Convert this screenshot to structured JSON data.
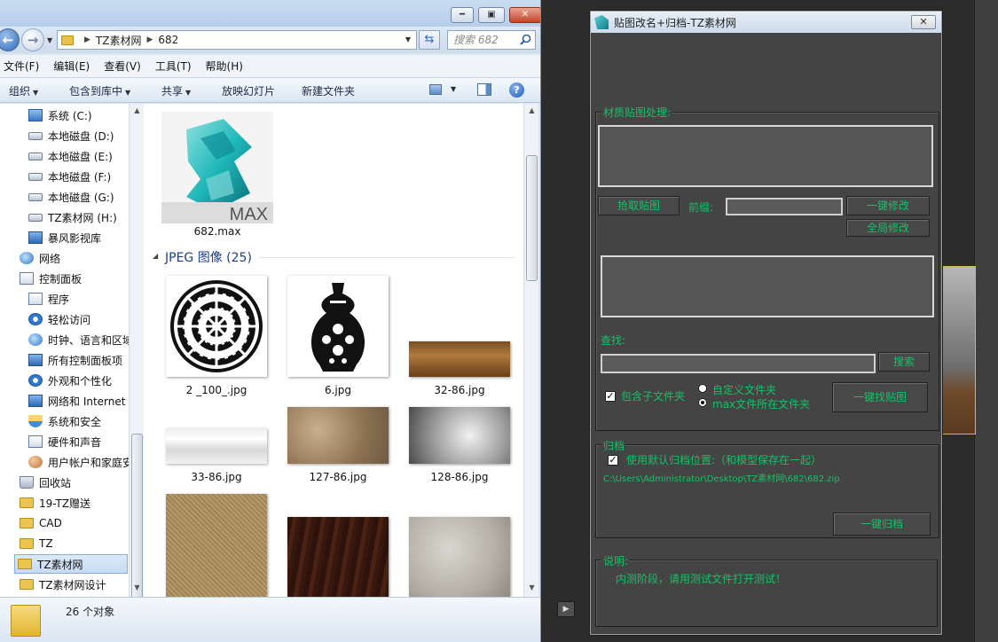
{
  "explorer": {
    "address": {
      "crumbs": [
        "TZ素材网",
        "682"
      ]
    },
    "search_placeholder": "搜索 682",
    "menu": [
      "文件(F)",
      "编辑(E)",
      "查看(V)",
      "工具(T)",
      "帮助(H)"
    ],
    "toolbar": {
      "organize": "组织",
      "include_library": "包含到库中",
      "share": "共享",
      "slideshow": "放映幻灯片",
      "new_folder": "新建文件夹"
    },
    "sidebar": [
      {
        "label": "系统 (C:)",
        "icon": "system-drive-icon"
      },
      {
        "label": "本地磁盘 (D:)",
        "icon": "drive-icon"
      },
      {
        "label": "本地磁盘 (E:)",
        "icon": "drive-icon"
      },
      {
        "label": "本地磁盘 (F:)",
        "icon": "drive-icon"
      },
      {
        "label": "本地磁盘 (G:)",
        "icon": "drive-icon"
      },
      {
        "label": "TZ素材网 (H:)",
        "icon": "drive-icon"
      },
      {
        "label": "暴风影视库",
        "icon": "media-library-icon"
      },
      {
        "label": "网络",
        "icon": "network-icon"
      },
      {
        "label": "控制面板",
        "icon": "control-panel-icon"
      },
      {
        "label": "程序",
        "icon": "programs-icon"
      },
      {
        "label": "轻松访问",
        "icon": "accessibility-icon"
      },
      {
        "label": "时钟、语言和区域",
        "icon": "clock-globe-icon"
      },
      {
        "label": "所有控制面板项",
        "icon": "control-panel-items-icon"
      },
      {
        "label": "外观和个性化",
        "icon": "appearance-icon"
      },
      {
        "label": "网络和 Internet",
        "icon": "network-internet-icon"
      },
      {
        "label": "系统和安全",
        "icon": "security-shield-icon"
      },
      {
        "label": "硬件和声音",
        "icon": "hardware-sound-icon"
      },
      {
        "label": "用户帐户和家庭安全",
        "icon": "user-accounts-icon"
      },
      {
        "label": "回收站",
        "icon": "recycle-bin-icon"
      },
      {
        "label": "19-TZ赠送",
        "icon": "folder-icon"
      },
      {
        "label": "CAD",
        "icon": "folder-icon"
      },
      {
        "label": "TZ",
        "icon": "folder-icon"
      },
      {
        "label": "TZ素材网",
        "icon": "folder-icon",
        "selected": true
      },
      {
        "label": "TZ素材网设计",
        "icon": "folder-icon"
      }
    ],
    "max_file": {
      "name": "682.max",
      "logo_text": "MAX"
    },
    "group_header": "JPEG 图像 (25)",
    "files": [
      "2 _100_.jpg",
      "6.jpg",
      "32-86.jpg",
      "33-86.jpg",
      "127-86.jpg",
      "128-86.jpg",
      "",
      "",
      ""
    ],
    "status": "26 个对象"
  },
  "dialog": {
    "title": "贴图改名+归档-TZ素材网",
    "close_label": "✕",
    "material_group_title": "材质贴图处理:",
    "pick_button": "拾取贴图",
    "prefix_label": "前缀:",
    "prefix_value": "",
    "modify_button": "一键修改",
    "global_modify_button": "全局修改",
    "find_label": "查找:",
    "find_value": "",
    "search_button": "搜索",
    "include_sub_label": "包含子文件夹",
    "include_sub_checked": true,
    "custom_folder_label": "自定义文件夹",
    "max_folder_label": "max文件所在文件夹",
    "find_maps_button": "一键找贴图",
    "archive_group_title": "归档",
    "default_archive_label": "使用默认归档位置:（和模型保存在一起）",
    "default_archive_checked": true,
    "archive_path": "C:\\Users\\Administrator\\Desktop\\TZ素材网\\682\\682.zip",
    "archive_button": "一键归档",
    "note_group_title": "说明:",
    "note_text": "内测阶段，请用测试文件打开测试！"
  }
}
